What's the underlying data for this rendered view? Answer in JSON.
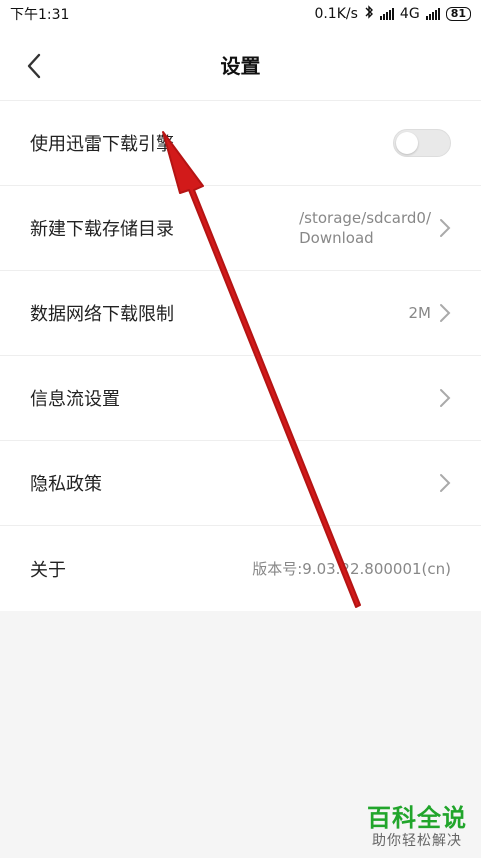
{
  "status": {
    "time": "下午1:31",
    "speed": "0.1K/s",
    "network": "4G",
    "battery": "81"
  },
  "header": {
    "title": "设置"
  },
  "settings": {
    "items": [
      {
        "label": "使用迅雷下载引擎",
        "type": "toggle"
      },
      {
        "label": "新建下载存储目录",
        "path_line1": "/storage/sdcard0/",
        "path_line2": "Download"
      },
      {
        "label": "数据网络下载限制",
        "value": "2M"
      },
      {
        "label": "信息流设置"
      },
      {
        "label": "隐私政策"
      },
      {
        "label": "关于",
        "value": "版本号:9.03.22.800001(cn)"
      }
    ]
  },
  "watermark": {
    "main": "百科全说",
    "sub": "助你轻松解决"
  },
  "colors": {
    "accent_red": "#d21a1a",
    "watermark_green": "#21a52b"
  },
  "icons": {
    "back": "chevron-left-icon",
    "chevron": "chevron-right-icon",
    "bluetooth": "bluetooth-icon",
    "signal": "signal-icon"
  }
}
